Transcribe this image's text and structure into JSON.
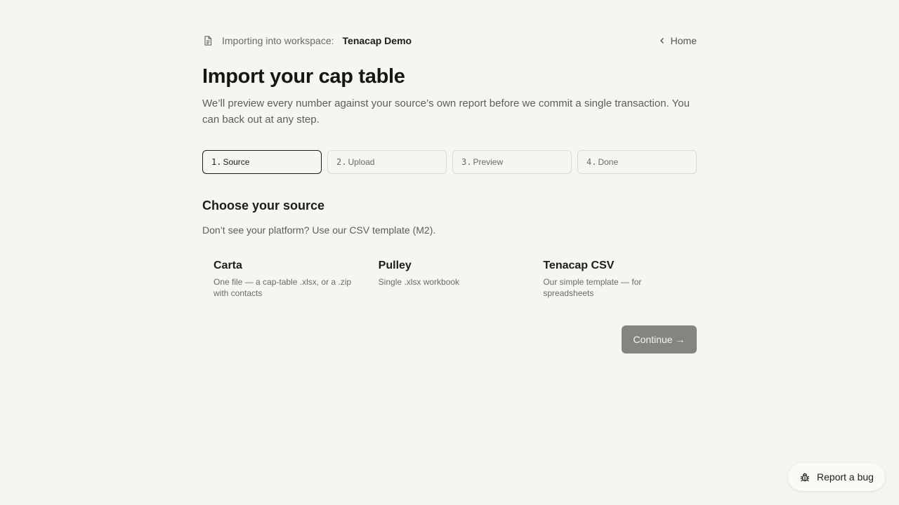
{
  "header": {
    "workspace_label": "Importing into workspace:",
    "workspace_name": "Tenacap Demo",
    "home_label": "Home"
  },
  "page": {
    "title": "Import your cap table",
    "subtitle": "We’ll preview every number against your source’s own report before we commit a single transaction. You can back out at any step."
  },
  "steps": [
    {
      "number": "1.",
      "label": "Source",
      "active": true
    },
    {
      "number": "2.",
      "label": "Upload",
      "active": false
    },
    {
      "number": "3.",
      "label": "Preview",
      "active": false
    },
    {
      "number": "4.",
      "label": "Done",
      "active": false
    }
  ],
  "source_section": {
    "heading": "Choose your source",
    "hint": "Don’t see your platform? Use our CSV template (M2).",
    "options": [
      {
        "title": "Carta",
        "description": "One file — a cap-table .xlsx, or a .zip with contacts"
      },
      {
        "title": "Pulley",
        "description": "Single .xlsx workbook"
      },
      {
        "title": "Tenacap CSV",
        "description": "Our simple template — for spreadsheets"
      }
    ]
  },
  "actions": {
    "continue_label": "Continue →"
  },
  "bug_report": {
    "label": "Report a bug"
  },
  "icons": {
    "workspace": "document-icon",
    "home": "chevron-left-icon",
    "bug": "bug-icon"
  },
  "colors": {
    "background": "#f7f5f1",
    "text": "#1c1c19",
    "muted": "#6b6a65",
    "button_disabled": "#858580"
  }
}
